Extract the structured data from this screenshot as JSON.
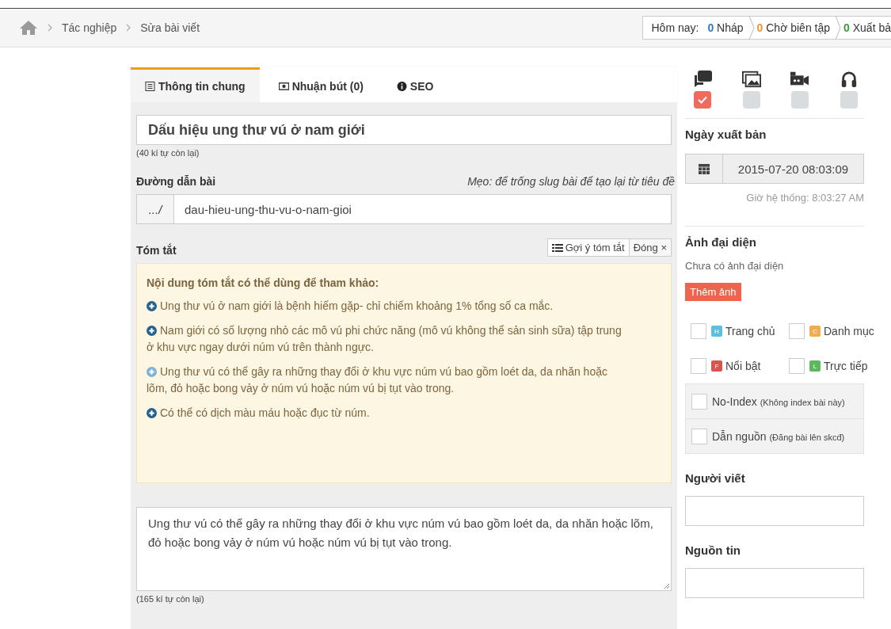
{
  "breadcrumb": {
    "items": [
      "Tác nghiệp",
      "Sửa bài viết"
    ]
  },
  "stats": {
    "label": "Hôm nay:",
    "items": [
      {
        "count": "0",
        "label": "Nháp",
        "color": "#337ab7"
      },
      {
        "count": "0",
        "label": "Chờ biên tập",
        "color": "#f0932b"
      },
      {
        "count": "0",
        "label": "Xuất bả",
        "color": "#3c9a3c"
      }
    ]
  },
  "tabs": [
    {
      "label": "Thông tin chung",
      "kind": "list",
      "selected": true
    },
    {
      "label": "Nhuận bút (0)",
      "kind": "money",
      "selected": false
    },
    {
      "label": "SEO",
      "kind": "info",
      "selected": false
    }
  ],
  "title_field": {
    "value": "Dấu hiệu ung thư vú ở nam giới",
    "counter": "(40 kí tự còn lại)"
  },
  "slug": {
    "label": "Đường dẫn bài",
    "tip": "Mẹo: để trống slug bài để tạo lại từ tiêu đề",
    "prefix": ".../",
    "value": "dau-hieu-ung-thu-vu-o-nam-gioi"
  },
  "summary": {
    "label": "Tóm tắt",
    "suggest_button": "Gợi ý tóm tắt",
    "close_button": "Đóng ×",
    "heading": "Nội dung tóm tắt có thể dùng để tham khảo:",
    "items": [
      {
        "text": "Ung thư vú ở nam giới là bệnh hiếm gặp- chỉ chiếm khoảng 1% tổng số ca mắc.",
        "used": false
      },
      {
        "text": "Nam giới có số lượng nhỏ các mô vú phi chức năng (mô vú không thể sản sinh sữa) tập trung ở khu vực ngay dưới núm vú trên thành ngực.",
        "used": false
      },
      {
        "text": "Ung thư vú có thể gây ra những thay đổi ở khu vực núm vú bao gồm loét da, da nhăn hoặc lõm, đỏ hoặc bong vảy ở núm vú hoặc núm vú bị tụt vào trong.",
        "used": true
      },
      {
        "text": "Có thể có dịch màu máu hoặc đục từ núm.",
        "used": false
      }
    ],
    "value": "Ung thư vú có thể gây ra những thay đổi ở khu vực núm vú bao gồm loét da, da nhăn hoặc lõm, đỏ hoặc bong vảy ở núm vú hoặc núm vú bị tụt vào trong.",
    "counter": "(165 kí tự còn lại)"
  },
  "media": [
    {
      "kind": "chat",
      "checked": true
    },
    {
      "kind": "images",
      "checked": false
    },
    {
      "kind": "video",
      "checked": false
    },
    {
      "kind": "audio",
      "checked": false
    }
  ],
  "publish": {
    "heading": "Ngày xuất bản",
    "value": "2015-07-20 08:03:09",
    "system_time": "Giờ hệ thống: 8:03:27 AM"
  },
  "avatar": {
    "heading": "Ảnh đại diện",
    "empty": "Chưa có ảnh đại diện",
    "button": "Thêm ảnh"
  },
  "flags": [
    {
      "badge": "H",
      "label": "Trang chủ",
      "color": "#5bc0de",
      "checked": false
    },
    {
      "badge": "C",
      "label": "Danh mục",
      "color": "#f0ad4e",
      "checked": false
    },
    {
      "badge": "F",
      "label": "Nổi bật",
      "color": "#d9534f",
      "checked": false
    },
    {
      "badge": "L",
      "label": "Trực tiếp",
      "color": "#5cb85c",
      "checked": false
    }
  ],
  "options": [
    {
      "label": "No-Index",
      "note": "(Không index bài này)",
      "checked": false
    },
    {
      "label": "Dẫn nguồn",
      "note": "(Đăng bài lên skcđ)",
      "checked": false
    }
  ],
  "author": {
    "heading": "Người viết"
  },
  "source": {
    "heading": "Nguồn tin"
  }
}
